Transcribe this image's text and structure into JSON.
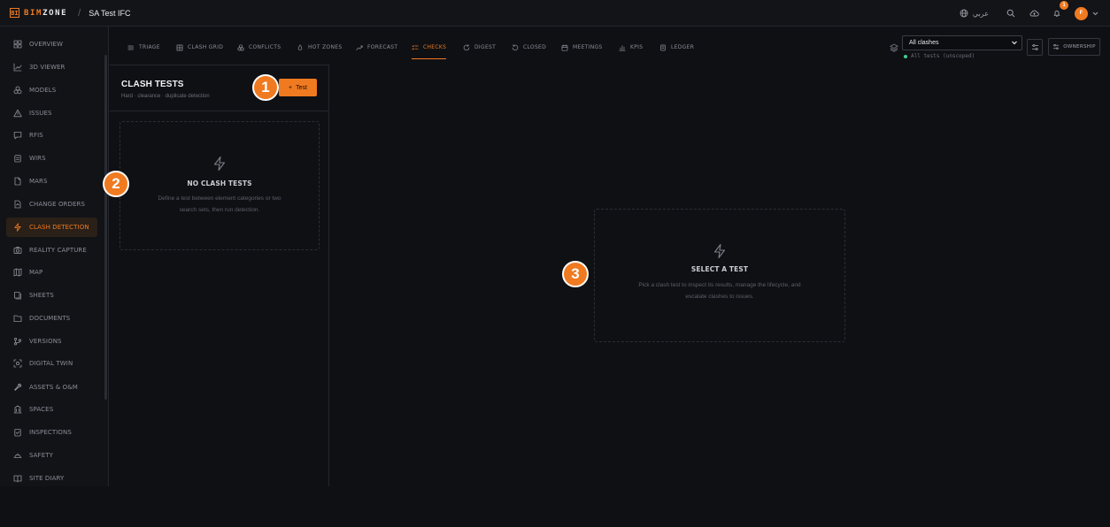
{
  "brand": {
    "mark": "BI",
    "name_accent": "BIM",
    "name_rest": "ZONE"
  },
  "breadcrumb": {
    "separator": "/",
    "project": "SA Test IFC"
  },
  "topbar": {
    "language": "عربي",
    "notification_count": "1",
    "avatar_initial": "F"
  },
  "sidebar": {
    "items": [
      {
        "label": "OVERVIEW",
        "icon": "grid-icon"
      },
      {
        "label": "3D VIEWER",
        "icon": "chart-line-icon"
      },
      {
        "label": "MODELS",
        "icon": "boxes-icon"
      },
      {
        "label": "ISSUES",
        "icon": "warning-icon"
      },
      {
        "label": "RFIS",
        "icon": "message-icon"
      },
      {
        "label": "WIRS",
        "icon": "clipboard-icon"
      },
      {
        "label": "MARS",
        "icon": "file-icon"
      },
      {
        "label": "CHANGE ORDERS",
        "icon": "change-icon"
      },
      {
        "label": "CLASH DETECTION",
        "icon": "bolt-icon",
        "active": true
      },
      {
        "label": "REALITY CAPTURE",
        "icon": "camera-icon"
      },
      {
        "label": "MAP",
        "icon": "map-icon"
      },
      {
        "label": "SHEETS",
        "icon": "sheets-icon"
      },
      {
        "label": "DOCUMENTS",
        "icon": "folder-icon"
      },
      {
        "label": "VERSIONS",
        "icon": "branch-icon"
      },
      {
        "label": "DIGITAL TWIN",
        "icon": "scan-icon"
      },
      {
        "label": "ASSETS & O&M",
        "icon": "wrench-icon"
      },
      {
        "label": "SPACES",
        "icon": "building-icon"
      },
      {
        "label": "INSPECTIONS",
        "icon": "checklist-icon"
      },
      {
        "label": "SAFETY",
        "icon": "helmet-icon"
      },
      {
        "label": "SITE DIARY",
        "icon": "book-icon"
      }
    ]
  },
  "tabs": [
    {
      "label": "TRIAGE"
    },
    {
      "label": "CLASH GRID"
    },
    {
      "label": "CONFLICTS"
    },
    {
      "label": "HOT ZONES"
    },
    {
      "label": "FORECAST"
    },
    {
      "label": "CHECKS",
      "active": true
    },
    {
      "label": "DIGEST"
    },
    {
      "label": "CLOSED"
    },
    {
      "label": "MEETINGS"
    },
    {
      "label": "KPIS"
    },
    {
      "label": "LEDGER"
    }
  ],
  "filter": {
    "selected": "All clashes",
    "scope": "All tests (unscoped)"
  },
  "ownership_label": "OWNERSHIP",
  "panel": {
    "title": "CLASH TESTS",
    "subtitle": "Hard · clearance · duplicate detection",
    "add_label": "Test",
    "empty_title": "NO CLASH TESTS",
    "empty_line1": "Define a test between element categories or two",
    "empty_line2": "search sets, then run detection."
  },
  "detail": {
    "title": "SELECT A TEST",
    "line1": "Pick a clash test to inspect its results, manage the lifecycle, and",
    "line2": "escalate clashes to issues."
  },
  "markers": [
    "1",
    "2",
    "3"
  ],
  "colors": {
    "accent": "#f07a20",
    "background": "#0f1014",
    "success": "#3ecf8e"
  }
}
